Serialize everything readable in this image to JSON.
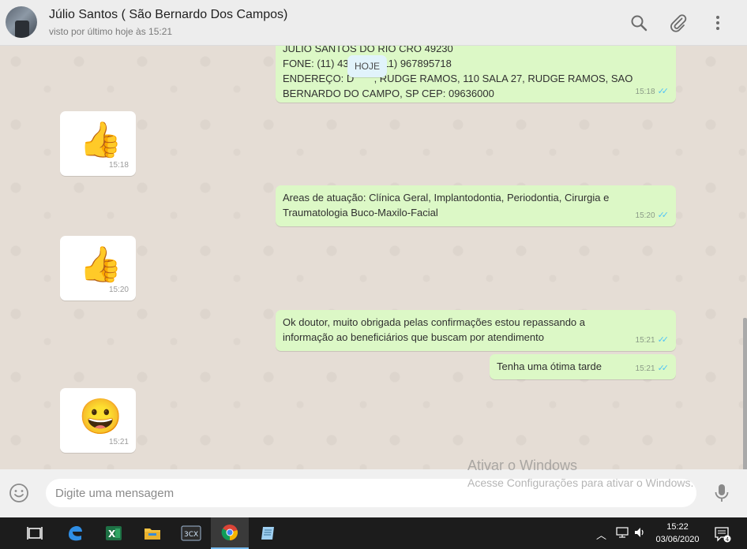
{
  "header": {
    "contact_name": "Júlio Santos ( São Bernardo Dos Campos)",
    "last_seen": "visto por último hoje às 15:21",
    "icons": [
      "search-icon",
      "attach-icon",
      "menu-icon"
    ]
  },
  "chat": {
    "date_badge": "HOJE",
    "messages": [
      {
        "direction": "out",
        "text": "JULIO SANTOS DO RIO CRO 49230\nFONE: (11) 43         | (11) 967895718\nENDEREÇO: D       , RUDGE RAMOS, 110 SALA 27, RUDGE RAMOS, SAO\nBERNARDO DO CAMPO, SP CEP: 09636000",
        "time": "15:18"
      },
      {
        "direction": "in",
        "emoji": "👍",
        "time": "15:18"
      },
      {
        "direction": "out",
        "text": "Areas de atuação: Clínica Geral, Implantodontia, Periodontia, Cirurgia e\nTraumatologia Buco-Maxilo-Facial",
        "time": "15:20"
      },
      {
        "direction": "in",
        "emoji": "👍",
        "time": "15:20"
      },
      {
        "direction": "out",
        "text": "Ok doutor, muito obrigada pelas confirmações estou repassando a\ninformação ao beneficiários que buscam por atendimento",
        "time": "15:21"
      },
      {
        "direction": "out",
        "text": "Tenha uma ótima tarde",
        "time": "15:21"
      },
      {
        "direction": "in",
        "emoji": "😀",
        "time": "15:21"
      }
    ]
  },
  "composer": {
    "placeholder": "Digite uma mensagem"
  },
  "watermark": {
    "line1": "Ativar o Windows",
    "line2": "Acesse Configurações para ativar o Windows."
  },
  "taskbar": {
    "apps": [
      "task-view-icon",
      "edge-icon",
      "excel-icon",
      "file-explorer-icon",
      "3cx-icon",
      "chrome-icon",
      "notepad-icon"
    ],
    "time": "15:22",
    "date": "03/06/2020",
    "notification_count": "4"
  }
}
